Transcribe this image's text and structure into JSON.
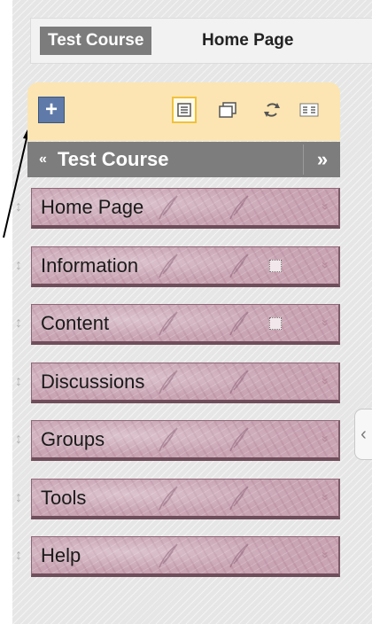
{
  "breadcrumb": {
    "course": "Test Course",
    "page": "Home Page"
  },
  "toolbar": {
    "add_label": "+",
    "icons": [
      "add-icon",
      "list-view-icon",
      "window-icon",
      "refresh-icon",
      "grid-view-icon"
    ]
  },
  "course_menu": {
    "collapse_glyph": "«",
    "title": "Test Course",
    "expand_glyph": "»"
  },
  "menu": {
    "items": [
      {
        "label": "Home Page",
        "has_empty_marker": false
      },
      {
        "label": "Information",
        "has_empty_marker": true
      },
      {
        "label": "Content",
        "has_empty_marker": true
      },
      {
        "label": "Discussions",
        "has_empty_marker": false
      },
      {
        "label": "Groups",
        "has_empty_marker": false
      },
      {
        "label": "Tools",
        "has_empty_marker": false
      },
      {
        "label": "Help",
        "has_empty_marker": false
      }
    ],
    "chevron_glyph": "»",
    "drag_glyph": "↕"
  },
  "side_tab": {
    "glyph": "‹"
  },
  "colors": {
    "menu_item_bg": "#c9a4b3",
    "course_bar_bg": "#7d7d7d",
    "toolbar_bg": "#fce5b2",
    "breadcrumb_course_bg": "#7c7c7c",
    "add_button_bg": "#5f7aa8"
  }
}
